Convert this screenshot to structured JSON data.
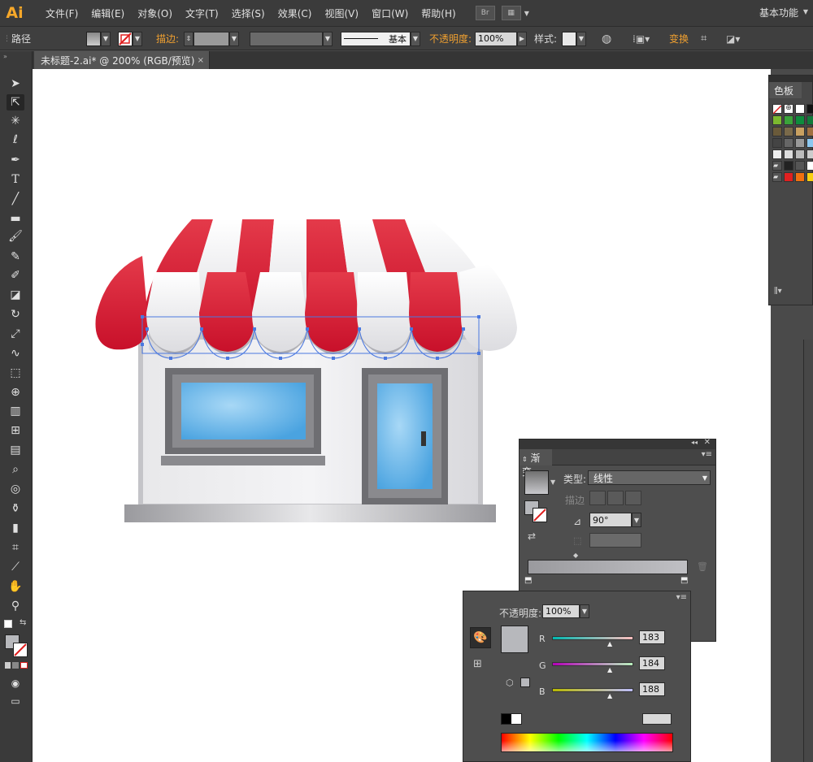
{
  "app": {
    "logo": "Ai",
    "workspace": "基本功能"
  },
  "menu": [
    "文件(F)",
    "编辑(E)",
    "对象(O)",
    "文字(T)",
    "选择(S)",
    "效果(C)",
    "视图(V)",
    "窗口(W)",
    "帮助(H)"
  ],
  "menu_buttons": {
    "bridge": "Br"
  },
  "control": {
    "object_type": "路径",
    "stroke_label": "描边:",
    "stroke_style": "基本",
    "opacity_label": "不透明度:",
    "opacity_value": "100%",
    "style_label": "样式:",
    "transform_label": "变换"
  },
  "document": {
    "tab_title": "未标题-2.ai* @ 200% (RGB/预览)",
    "close": "×"
  },
  "swatches": {
    "title": "色板"
  },
  "gradient": {
    "title": "渐变",
    "type_label": "类型:",
    "type_value": "线性",
    "stroke_label": "描边",
    "angle_value": "90°"
  },
  "color": {
    "opacity_label": "不透明度:",
    "opacity_value": "100%",
    "r_label": "R",
    "r_value": "183",
    "g_label": "G",
    "g_value": "184",
    "b_label": "B",
    "b_value": "188"
  },
  "colors": {
    "accent": "#f7a829",
    "awning_red": "#d6182e",
    "window_blue": "#5fb3e8",
    "selection": "#4a78e0",
    "fill_gray": "#b7b8bc"
  },
  "icons": [
    "selection-tool-icon",
    "direct-selection-tool-icon",
    "magic-wand-icon",
    "lasso-icon",
    "pen-icon",
    "type-icon",
    "line-icon",
    "rectangle-icon",
    "paintbrush-icon",
    "pencil-icon",
    "blob-brush-icon",
    "eraser-icon",
    "rotate-icon",
    "scale-icon",
    "warp-icon",
    "free-transform-icon",
    "shape-builder-icon",
    "perspective-icon",
    "mesh-icon",
    "gradient-icon",
    "eyedropper-icon",
    "blend-icon",
    "symbol-sprayer-icon",
    "column-graph-icon",
    "artboard-icon",
    "slice-icon",
    "hand-icon",
    "zoom-icon"
  ]
}
